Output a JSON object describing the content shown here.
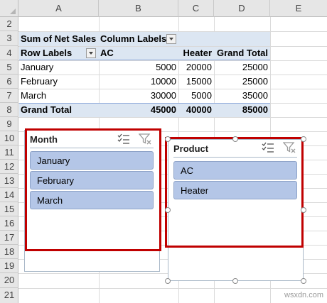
{
  "columns": [
    "A",
    "B",
    "C",
    "D",
    "E"
  ],
  "rows": [
    "2",
    "3",
    "4",
    "5",
    "6",
    "7",
    "8",
    "9",
    "10",
    "11",
    "12",
    "13",
    "14",
    "15",
    "16",
    "17",
    "18",
    "19",
    "20",
    "21"
  ],
  "pivot": {
    "header": {
      "sum_label": "Sum of Net Sales",
      "col_labels": "Column Labels",
      "row_labels": "Row Labels",
      "ac": "AC",
      "heater": "Heater",
      "grand_total": "Grand Total"
    },
    "rows": [
      {
        "label": "January",
        "ac": "5000",
        "heater": "20000",
        "total": "25000"
      },
      {
        "label": "February",
        "ac": "10000",
        "heater": "15000",
        "total": "25000"
      },
      {
        "label": "March",
        "ac": "30000",
        "heater": "5000",
        "total": "35000"
      }
    ],
    "total": {
      "label": "Grand Total",
      "ac": "45000",
      "heater": "40000",
      "total": "85000"
    }
  },
  "slicer_month": {
    "title": "Month",
    "items": [
      "January",
      "February",
      "March"
    ],
    "icons": [
      "multi-select-icon",
      "clear-filter-icon"
    ]
  },
  "slicer_product": {
    "title": "Product",
    "items": [
      "AC",
      "Heater"
    ],
    "icons": [
      "multi-select-icon",
      "clear-filter-icon"
    ]
  },
  "highlight_color": "#c00000",
  "pivot_shade_color": "#dce6f2",
  "slicer_item_color": "#b4c6e7",
  "watermark": "wsxdn.com"
}
